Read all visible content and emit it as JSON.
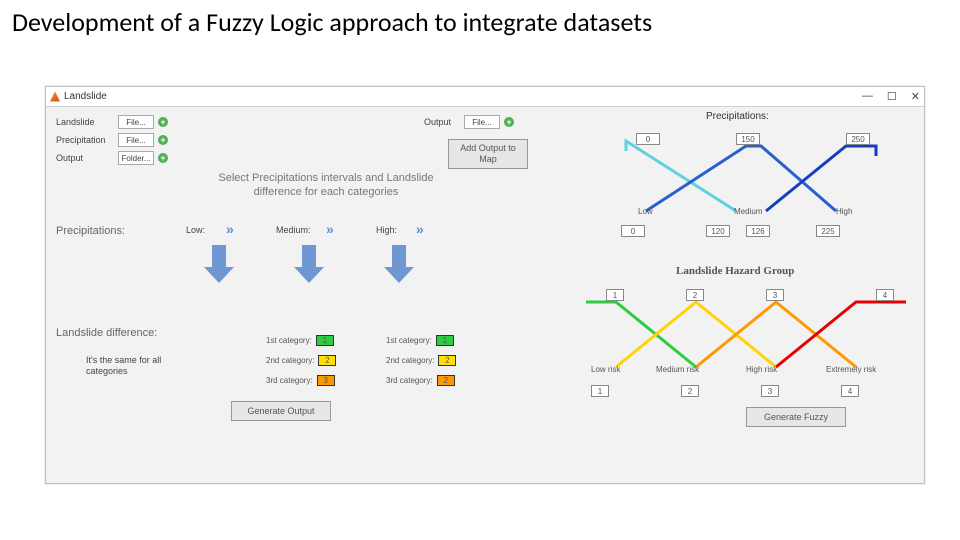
{
  "slide": {
    "title": "Development of a Fuzzy Logic approach to integrate datasets"
  },
  "window": {
    "title": "Landslide",
    "minimize": "—",
    "maximize": "☐",
    "close": "✕"
  },
  "inputs": {
    "landslide_label": "Landslide",
    "precip_label": "Precipitation",
    "output_label": "Output",
    "file_btn": "File...",
    "folder_btn": "Folder...",
    "output_file_label": "Output",
    "add_output_btn": "Add Output to\nMap"
  },
  "mid": {
    "instruction": "Select Precipitations intervals and Landslide difference for each categories",
    "precip_row_label": "Precipitations:",
    "low": "Low:",
    "medium": "Medium:",
    "high": "High:",
    "landslide_diff_label": "Landslide difference:",
    "same_note": "It's the same for all categories",
    "cat1": "1st category:",
    "cat2": "2nd category:",
    "cat3": "3rd category:",
    "v1": "1",
    "v2": "2",
    "v3": "3",
    "v3b": "2",
    "generate_output": "Generate Output"
  },
  "precip_chart": {
    "title": "Precipitations:",
    "top_v0": "0",
    "top_v1": "150",
    "top_v2": "250",
    "bot_v0": "0",
    "bot_v1": "120",
    "bot_v2": "126",
    "bot_v3": "225",
    "low": "Low",
    "medium": "Medium",
    "high": "High"
  },
  "hazard_chart": {
    "title": "Landslide Hazard Group",
    "t1": "1",
    "t2": "2",
    "t3": "3",
    "t4": "4",
    "b1": "1",
    "b2": "2",
    "b3": "3",
    "b4": "4",
    "low": "Low risk",
    "medium": "Medium risk",
    "high": "High risk",
    "extreme": "Extremely risk",
    "generate_fuzzy": "Generate Fuzzy"
  },
  "chart_data": [
    {
      "type": "line",
      "title": "Precipitations",
      "series": [
        {
          "name": "Low",
          "color": "#5fd1e0",
          "x": [
            0,
            120
          ],
          "y": [
            1,
            0
          ]
        },
        {
          "name": "Medium",
          "color": "#2a5fcf",
          "x": [
            0,
            126,
            150,
            225
          ],
          "y": [
            0,
            1,
            1,
            0
          ]
        },
        {
          "name": "High",
          "color": "#123fbf",
          "x": [
            150,
            225,
            250
          ],
          "y": [
            0,
            1,
            1
          ]
        }
      ],
      "xlim": [
        0,
        250
      ],
      "ylim": [
        0,
        1
      ]
    },
    {
      "type": "line",
      "title": "Landslide Hazard Group",
      "series": [
        {
          "name": "Low risk",
          "color": "#2ecc40",
          "x": [
            1,
            1.5,
            2
          ],
          "y": [
            1,
            1,
            0
          ]
        },
        {
          "name": "Medium risk",
          "color": "#ffd400",
          "x": [
            1,
            2,
            3
          ],
          "y": [
            0,
            1,
            0
          ]
        },
        {
          "name": "High risk",
          "color": "#ff9800",
          "x": [
            2,
            3,
            4
          ],
          "y": [
            0,
            1,
            0
          ]
        },
        {
          "name": "Extremely risk",
          "color": "#e60000",
          "x": [
            3,
            4,
            4.5
          ],
          "y": [
            0,
            1,
            1
          ]
        }
      ],
      "xlim": [
        1,
        4.5
      ],
      "ylim": [
        0,
        1
      ]
    }
  ]
}
